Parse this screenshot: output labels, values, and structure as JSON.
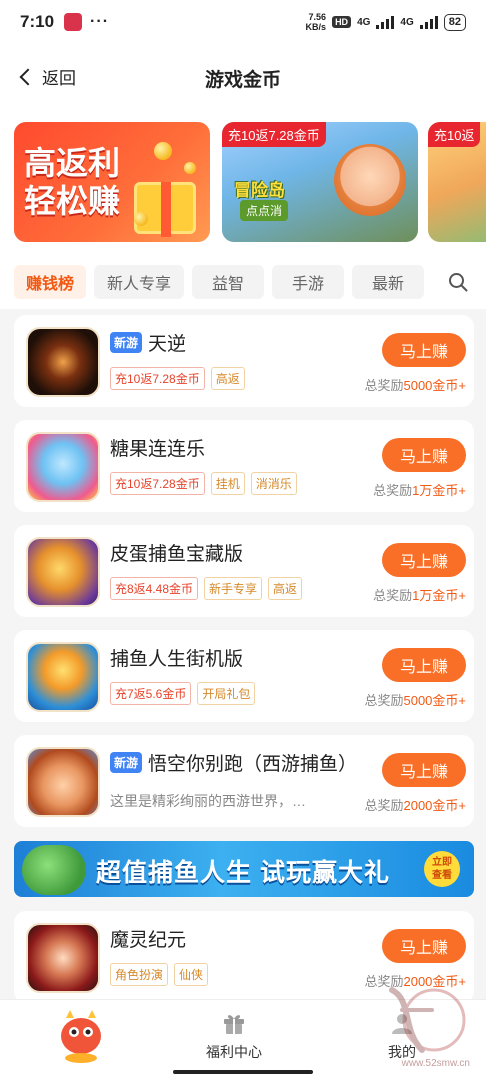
{
  "status_bar": {
    "time": "7:10",
    "dots": "···",
    "speed_value": "7.56",
    "speed_unit": "KB/s",
    "hd": "HD",
    "net1": "4G",
    "net2": "4G",
    "battery": "82"
  },
  "header": {
    "back_label": "返回",
    "title": "游戏金币"
  },
  "banners": [
    {
      "title_line1": "高返利",
      "title_line2": "轻松赚"
    },
    {
      "tag": "充10返7.28金币",
      "title": "冒险岛",
      "subtitle": "点点消"
    },
    {
      "tag": "充10返"
    }
  ],
  "tabs": [
    {
      "label": "赚钱榜",
      "active": true
    },
    {
      "label": "新人专享",
      "active": false
    },
    {
      "label": "益智",
      "active": false
    },
    {
      "label": "手游",
      "active": false
    },
    {
      "label": "最新",
      "active": false
    }
  ],
  "games": [
    {
      "name": "天逆",
      "badge": "新游",
      "tags": [
        {
          "text": "充10返7.28金币",
          "style": "red"
        },
        {
          "text": "高返",
          "style": "orange"
        }
      ],
      "button": "马上赚",
      "reward_prefix": "总奖励",
      "reward_amount": "5000金币+"
    },
    {
      "name": "糖果连连乐",
      "badge": "",
      "tags": [
        {
          "text": "充10返7.28金币",
          "style": "red"
        },
        {
          "text": "挂机",
          "style": "orange"
        },
        {
          "text": "消消乐",
          "style": "orange"
        }
      ],
      "button": "马上赚",
      "reward_prefix": "总奖励",
      "reward_amount": "1万金币+"
    },
    {
      "name": "皮蛋捕鱼宝藏版",
      "badge": "",
      "tags": [
        {
          "text": "充8返4.48金币",
          "style": "red"
        },
        {
          "text": "新手专享",
          "style": "orange"
        },
        {
          "text": "高返",
          "style": "orange"
        }
      ],
      "button": "马上赚",
      "reward_prefix": "总奖励",
      "reward_amount": "1万金币+"
    },
    {
      "name": "捕鱼人生街机版",
      "badge": "",
      "tags": [
        {
          "text": "充7返5.6金币",
          "style": "red"
        },
        {
          "text": "开局礼包",
          "style": "orange"
        }
      ],
      "button": "马上赚",
      "reward_prefix": "总奖励",
      "reward_amount": "5000金币+"
    },
    {
      "name": "悟空你别跑（西游捕鱼）",
      "badge": "新游",
      "desc": "这里是精彩绚丽的西游世界，…",
      "button": "马上赚",
      "reward_prefix": "总奖励",
      "reward_amount": "2000金币+"
    },
    {
      "name": "魔灵纪元",
      "badge": "",
      "tags": [
        {
          "text": "角色扮演",
          "style": "orange"
        },
        {
          "text": "仙侠",
          "style": "orange"
        }
      ],
      "button": "马上赚",
      "reward_prefix": "总奖励",
      "reward_amount": "2000金币+"
    }
  ],
  "promo": {
    "text": "超值捕鱼人生 试玩赢大礼",
    "cta_line1": "立即",
    "cta_line2": "查看"
  },
  "bottom_nav": {
    "welfare_label": "福利中心",
    "mine_label": "我的"
  },
  "watermark_url": "www.52smw.cn",
  "colors": {
    "accent": "#f96f27",
    "badge_blue": "#3f83f5",
    "tag_red": "#e8432b",
    "tag_orange": "#d5892a"
  }
}
